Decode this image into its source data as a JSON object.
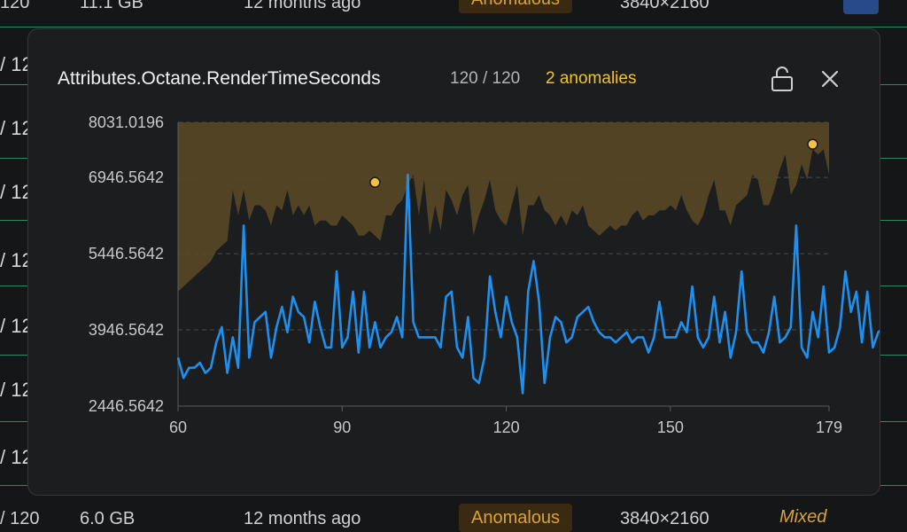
{
  "background": {
    "row_fragment": "/ 120",
    "top_row": {
      "count": "120",
      "size": "11.1 GB",
      "age": "12 months ago",
      "status": "Anomalous",
      "resolution": "3840×2160"
    },
    "bottom_row": {
      "count": "/ 120",
      "size": "6.0 GB",
      "age": "12 months ago",
      "status": "Anomalous",
      "resolution": "3840×2160",
      "tag": "Mixed"
    }
  },
  "modal": {
    "title": "Attributes.Octane.RenderTimeSeconds",
    "count_label": "120 / 120",
    "anomalies_label": "2 anomalies",
    "icons": {
      "lock": "unlock-icon",
      "close": "close-icon"
    }
  },
  "colors": {
    "line": "#1e90f0",
    "band": "#5a4a25",
    "anomaly": "#f5c042",
    "background": "#1b1d1f"
  },
  "chart_data": {
    "type": "line",
    "title": "",
    "xlabel": "",
    "ylabel": "",
    "x_range": [
      60,
      179
    ],
    "y_range": [
      2446.5642,
      8031.0196
    ],
    "x_ticks": [
      "60",
      "90",
      "120",
      "150",
      "179"
    ],
    "y_ticks": [
      "8031.0196",
      "6946.5642",
      "5446.5642",
      "3946.5642",
      "2446.5642"
    ],
    "grid": "horizontal dashed",
    "legend": "none",
    "series": [
      {
        "x_start": 60,
        "values": [
          3400,
          3000,
          3200,
          3200,
          3300,
          3100,
          3200,
          3700,
          4000,
          3100,
          3800,
          3200,
          6000,
          3400,
          4100,
          4200,
          4300,
          3400,
          4000,
          4400,
          3900,
          4600,
          4300,
          4200,
          3700,
          4500,
          4000,
          3600,
          3600,
          5100,
          3600,
          3800,
          4700,
          3500,
          4700,
          3600,
          4100,
          3600,
          3800,
          3900,
          4200,
          3800,
          7000,
          4100,
          3800,
          3800,
          3800,
          3800,
          3600,
          4600,
          4700,
          3600,
          3400,
          4200,
          3000,
          2900,
          3400,
          5000,
          4300,
          3800,
          4600,
          4100,
          3800,
          2700,
          4700,
          5300,
          4500,
          2900,
          3800,
          4200,
          4100,
          3700,
          3800,
          4200,
          4300,
          4400,
          4100,
          3900,
          3800,
          3800,
          3700,
          3800,
          3900,
          3700,
          3800,
          3800,
          3500,
          3800,
          4500,
          3800,
          3800,
          3800,
          4100,
          3900,
          4800,
          3800,
          3600,
          3800,
          4600,
          3700,
          4300,
          3400,
          3900,
          5100,
          3900,
          3700,
          3700,
          3500,
          3900,
          4600,
          3700,
          3800,
          4000,
          6000,
          3600,
          3400,
          4300,
          3800,
          4800,
          3500,
          3600,
          4000,
          5100,
          4300,
          4700,
          3700,
          4700,
          3600,
          3900,
          4000
        ],
        "anomalies": [
          {
            "x": 96,
            "y": 6850
          },
          {
            "x": 176,
            "y": 7600
          }
        ]
      }
    ],
    "upper_band_top": 8031.0196,
    "upper_band_bottom": [
      4700,
      4800,
      4900,
      5000,
      5100,
      5200,
      5300,
      5500,
      5600,
      5700,
      6700,
      6200,
      6700,
      6100,
      6400,
      6400,
      6300,
      6000,
      6400,
      6300,
      6700,
      6200,
      6400,
      6200,
      6400,
      6000,
      6100,
      6100,
      6000,
      6000,
      6200,
      6100,
      6000,
      5800,
      5800,
      5900,
      5800,
      5700,
      6200,
      6200,
      6400,
      6500,
      6800,
      7000,
      6200,
      6900,
      5800,
      6400,
      5900,
      6700,
      6500,
      6200,
      6600,
      6800,
      5800,
      6200,
      6500,
      6900,
      6300,
      6100,
      6000,
      6400,
      6800,
      5800,
      6400,
      6400,
      6600,
      6300,
      6200,
      6000,
      6200,
      6000,
      6300,
      6200,
      6400,
      6000,
      5900,
      5800,
      5900,
      6000,
      5900,
      6000,
      6000,
      6200,
      6300,
      6100,
      6200,
      6200,
      6300,
      6300,
      6400,
      6300,
      6600,
      6300,
      6100,
      6000,
      6200,
      6600,
      6900,
      6300,
      6300,
      6000,
      6400,
      6500,
      6600,
      7000,
      6900,
      6400,
      6400,
      6700,
      7100,
      7400,
      6600,
      6800,
      7200,
      6900,
      7500,
      7400,
      7500,
      7000
    ]
  }
}
